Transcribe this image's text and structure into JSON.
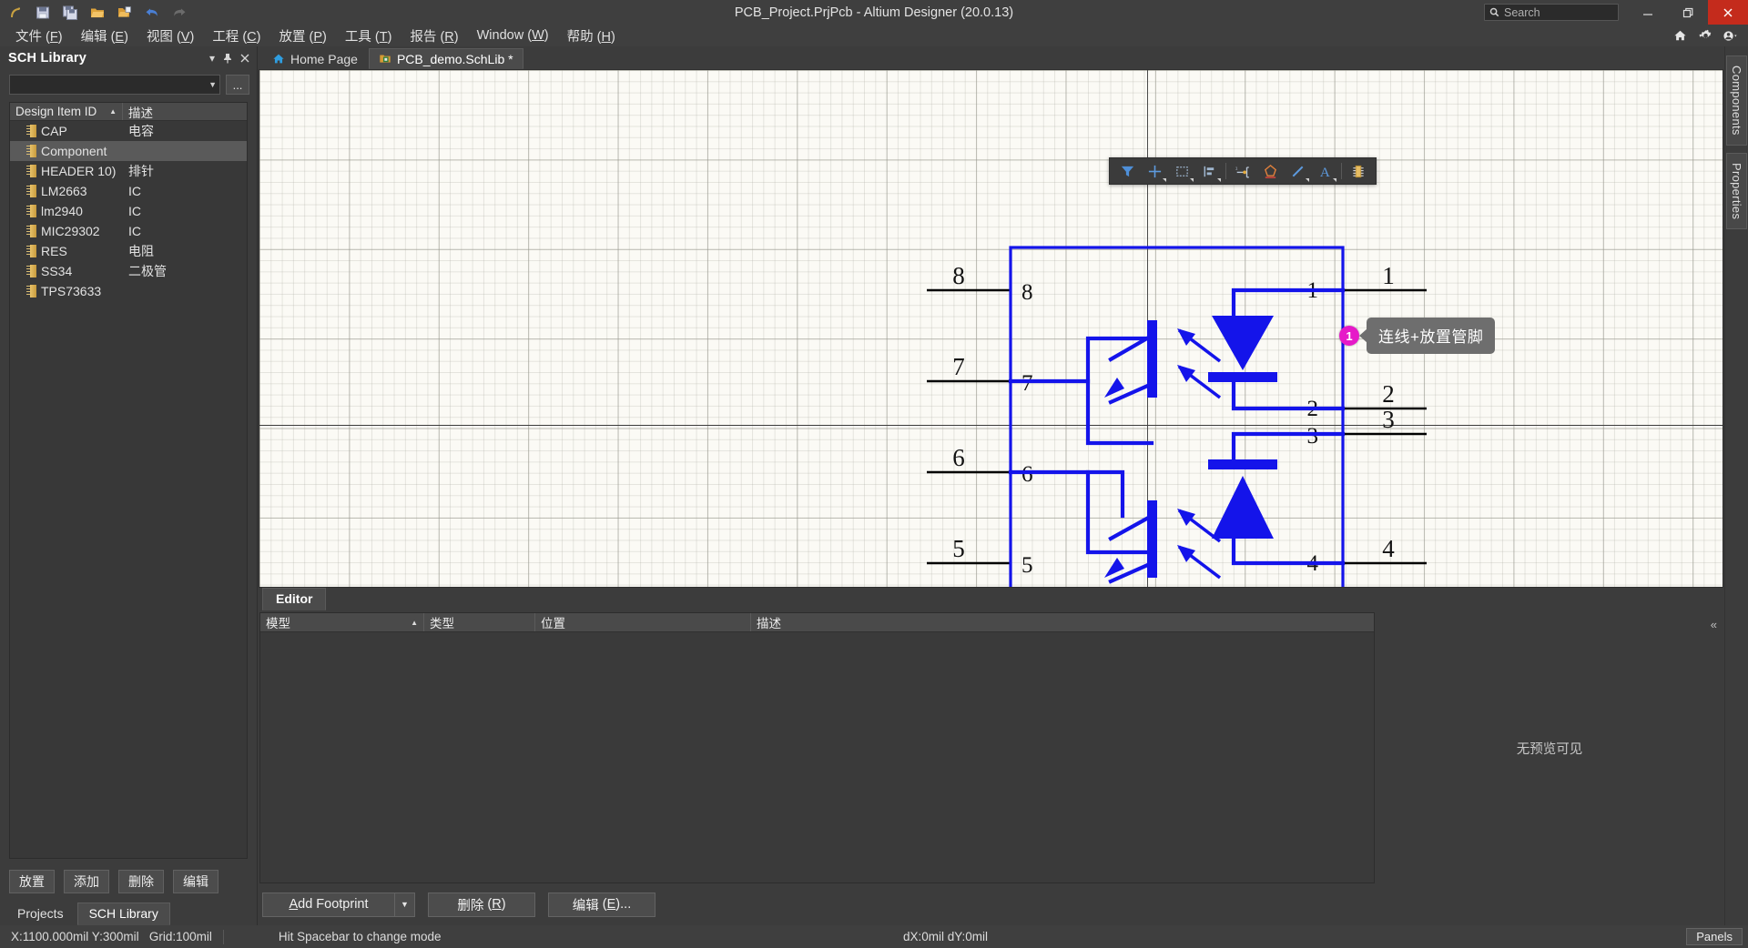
{
  "window": {
    "title": "PCB_Project.PrjPcb - Altium Designer (20.0.13)",
    "search_placeholder": "Search",
    "minimize": "—",
    "restore": "❐",
    "close": "✕"
  },
  "quick_access": [
    {
      "name": "altium-logo-icon",
      "label": "A"
    },
    {
      "name": "save-icon",
      "label": "Save"
    },
    {
      "name": "save-all-icon",
      "label": "Save All"
    },
    {
      "name": "open-icon",
      "label": "Open"
    },
    {
      "name": "open-project-icon",
      "label": "Open Project"
    },
    {
      "name": "undo-icon",
      "label": "Undo"
    },
    {
      "name": "redo-icon",
      "label": "Redo"
    }
  ],
  "menubar": {
    "items": [
      {
        "text": "文件",
        "key": "F"
      },
      {
        "text": "编辑",
        "key": "E"
      },
      {
        "text": "视图",
        "key": "V"
      },
      {
        "text": "工程",
        "key": "C"
      },
      {
        "text": "放置",
        "key": "P"
      },
      {
        "text": "工具",
        "key": "T"
      },
      {
        "text": "报告",
        "key": "R"
      },
      {
        "text": "Window",
        "key": "W"
      },
      {
        "text": "帮助",
        "key": "H"
      }
    ],
    "right_icons": [
      "home-icon",
      "gear-icon",
      "account-icon"
    ]
  },
  "sch_library_panel": {
    "title": "SCH Library",
    "controls": [
      "chevron-down-icon",
      "pin-icon",
      "close-icon"
    ],
    "filter_value": "",
    "browse_button": "...",
    "columns": [
      {
        "label": "Design Item ID",
        "sorted": true
      },
      {
        "label": "描述",
        "sorted": false
      }
    ],
    "items": [
      {
        "id": "CAP",
        "desc": "电容",
        "selected": false
      },
      {
        "id": "Component",
        "desc": "",
        "selected": true
      },
      {
        "id": "HEADER 10)",
        "desc": "排针",
        "selected": false
      },
      {
        "id": "LM2663",
        "desc": "IC",
        "selected": false
      },
      {
        "id": "lm2940",
        "desc": "IC",
        "selected": false
      },
      {
        "id": "MIC29302",
        "desc": "IC",
        "selected": false
      },
      {
        "id": "RES",
        "desc": "电阻",
        "selected": false
      },
      {
        "id": "SS34",
        "desc": "二极管",
        "selected": false
      },
      {
        "id": "TPS73633",
        "desc": "",
        "selected": false
      }
    ],
    "buttons": [
      "放置",
      "添加",
      "删除",
      "编辑"
    ],
    "bottom_tabs": [
      {
        "label": "Projects",
        "active": false
      },
      {
        "label": "SCH Library",
        "active": true
      }
    ]
  },
  "document_tabs": [
    {
      "label": "Home Page",
      "icon": "home-icon",
      "active": false,
      "modified": false
    },
    {
      "label": "PCB_demo.SchLib *",
      "icon": "schlib-icon",
      "active": true,
      "modified": true
    }
  ],
  "canvas_toolbar": [
    {
      "name": "filter-icon",
      "menu": false
    },
    {
      "name": "crosshair-place-icon",
      "menu": true
    },
    {
      "name": "rectangle-select-icon",
      "menu": true
    },
    {
      "name": "align-icon",
      "menu": true
    },
    {
      "name": "place-pin-icon",
      "menu": false
    },
    {
      "name": "polygon-icon",
      "menu": false
    },
    {
      "name": "line-icon",
      "menu": true
    },
    {
      "name": "text-icon",
      "menu": true
    },
    {
      "name": "component-icon",
      "menu": false
    }
  ],
  "callout": {
    "number": "1",
    "text": "连线+放置管脚",
    "badge_color": "#e619c8",
    "bubble_color": "#6e6e6e"
  },
  "schematic": {
    "symbol": "dual-optocoupler",
    "body_color": "#1414ea",
    "wire_color": "#000000",
    "left_pins": [
      {
        "pin": "8",
        "net": "8"
      },
      {
        "pin": "7",
        "net": "7"
      },
      {
        "pin": "6",
        "net": "6"
      },
      {
        "pin": "5",
        "net": "5"
      }
    ],
    "right_pins": [
      {
        "pin": "1",
        "net": "1"
      },
      {
        "pin": "2",
        "net": "2"
      },
      {
        "pin": "3",
        "net": "3"
      },
      {
        "pin": "4",
        "net": "4"
      }
    ]
  },
  "editor_panel": {
    "tab": "Editor",
    "columns": [
      "模型",
      "类型",
      "位置",
      "描述"
    ],
    "sort_column": "模型",
    "rows": [],
    "preview_text": "无预览可见",
    "buttons": {
      "add_footprint": "Add Footprint",
      "add_footprint_accel": "A",
      "delete": "删除",
      "delete_key": "R",
      "edit": "编辑",
      "edit_key": "E",
      "edit_suffix": "..."
    }
  },
  "right_dock_tabs": [
    "Components",
    "Properties"
  ],
  "statusbar": {
    "coords": "X:1100.000mil Y:300mil",
    "grid": "Grid:100mil",
    "hint": "Hit Spacebar to change mode",
    "delta": "dX:0mil dY:0mil",
    "panels_button": "Panels"
  }
}
